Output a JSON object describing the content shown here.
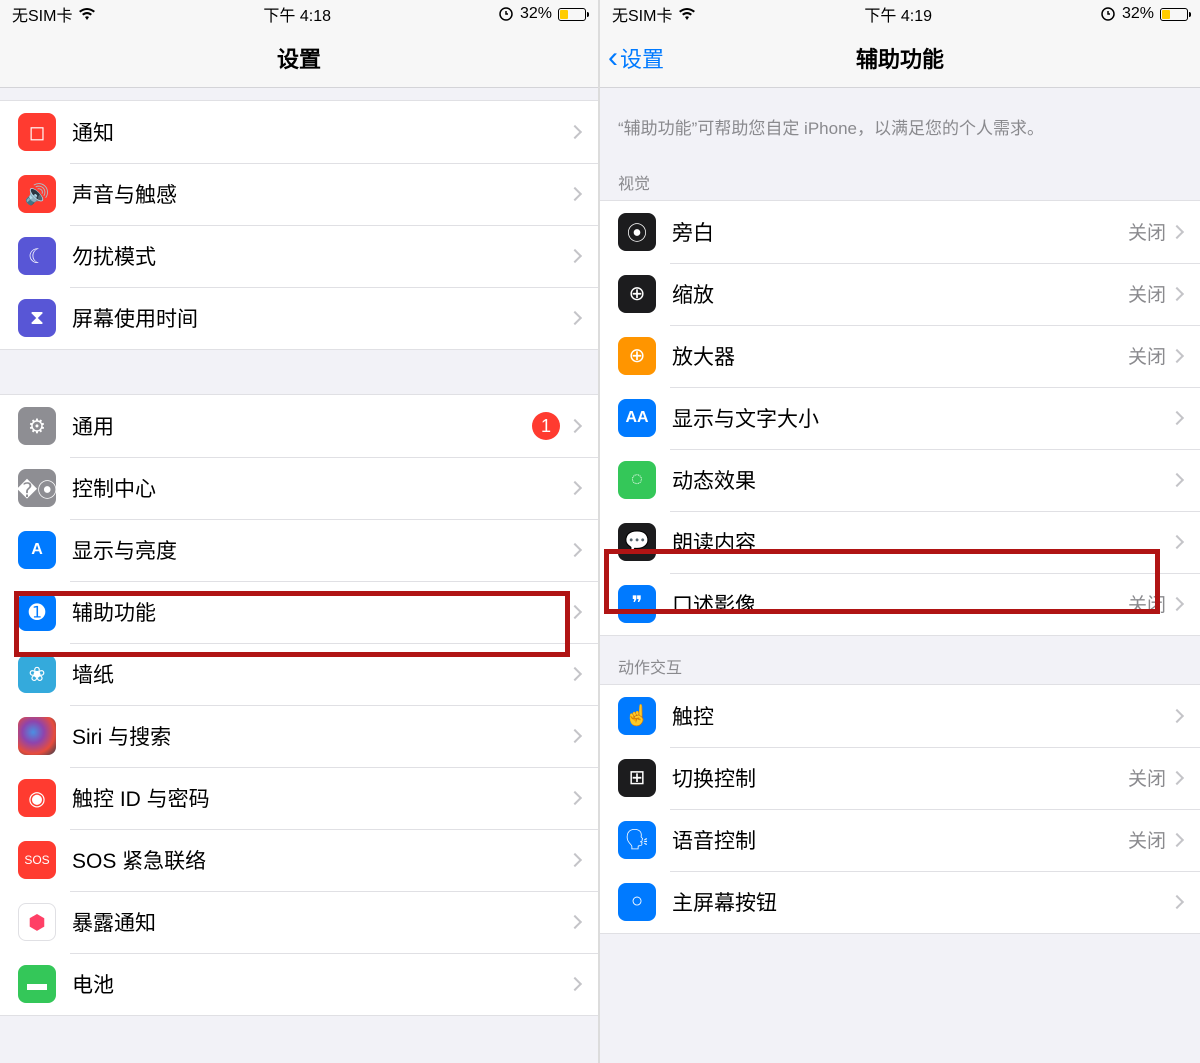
{
  "left": {
    "status": {
      "carrier": "无SIM卡",
      "time": "下午 4:18",
      "battery": "32%"
    },
    "title": "设置",
    "groups": [
      [
        {
          "key": "notifications",
          "label": "通知",
          "icon": "notification-icon",
          "iconClass": "ic-red",
          "glyph": "◻"
        },
        {
          "key": "sounds",
          "label": "声音与触感",
          "icon": "sound-icon",
          "iconClass": "ic-red",
          "glyph": "🔊"
        },
        {
          "key": "dnd",
          "label": "勿扰模式",
          "icon": "moon-icon",
          "iconClass": "ic-purple",
          "glyph": "☾"
        },
        {
          "key": "screentime",
          "label": "屏幕使用时间",
          "icon": "hourglass-icon",
          "iconClass": "ic-purple",
          "glyph": "⧗"
        }
      ],
      [
        {
          "key": "general",
          "label": "通用",
          "icon": "gear-icon",
          "iconClass": "ic-gray",
          "glyph": "⚙",
          "badge": "1"
        },
        {
          "key": "control",
          "label": "控制中心",
          "icon": "switches-icon",
          "iconClass": "ic-gray",
          "glyph": "�⦿"
        },
        {
          "key": "display",
          "label": "显示与亮度",
          "icon": "display-icon",
          "iconClass": "ic-blue",
          "glyph": "A"
        },
        {
          "key": "accessibility",
          "label": "辅助功能",
          "icon": "accessibility-icon",
          "iconClass": "ic-blue",
          "glyph": "➊",
          "highlight": true
        },
        {
          "key": "wallpaper",
          "label": "墙纸",
          "icon": "wallpaper-icon",
          "iconClass": "ic-cyan",
          "glyph": "❀"
        },
        {
          "key": "siri",
          "label": "Siri 与搜索",
          "icon": "siri-icon",
          "iconClass": "ic-siri",
          "glyph": ""
        },
        {
          "key": "touchid",
          "label": "触控 ID 与密码",
          "icon": "fingerprint-icon",
          "iconClass": "ic-red",
          "glyph": "◉"
        },
        {
          "key": "sos",
          "label": "SOS 紧急联络",
          "icon": "sos-icon",
          "iconClass": "ic-red",
          "glyph": "SOS",
          "small": true
        },
        {
          "key": "exposure",
          "label": "暴露通知",
          "icon": "exposure-icon",
          "iconClass": "ic-exposure",
          "glyph": "⬢"
        },
        {
          "key": "battery",
          "label": "电池",
          "icon": "battery-icon",
          "iconClass": "ic-green",
          "glyph": "▬"
        }
      ]
    ]
  },
  "right": {
    "status": {
      "carrier": "无SIM卡",
      "time": "下午 4:19",
      "battery": "32%"
    },
    "back": "设置",
    "title": "辅助功能",
    "description": "“辅助功能”可帮助您自定 iPhone，以满足您的个人需求。",
    "sections": [
      {
        "header": "视觉",
        "items": [
          {
            "key": "voiceover",
            "label": "旁白",
            "icon": "voiceover-icon",
            "iconClass": "ic-darker",
            "glyph": "⦿",
            "value": "关闭"
          },
          {
            "key": "zoom",
            "label": "缩放",
            "icon": "zoom-icon",
            "iconClass": "ic-darker",
            "glyph": "⊕",
            "value": "关闭"
          },
          {
            "key": "magnifier",
            "label": "放大器",
            "icon": "magnifier-icon",
            "iconClass": "ic-orange",
            "glyph": "⊕",
            "value": "关闭"
          },
          {
            "key": "textsize",
            "label": "显示与文字大小",
            "icon": "textsize-icon",
            "iconClass": "ic-blue",
            "glyph": "AA"
          },
          {
            "key": "motion",
            "label": "动态效果",
            "icon": "motion-icon",
            "iconClass": "ic-green",
            "glyph": "◌"
          },
          {
            "key": "spoken",
            "label": "朗读内容",
            "icon": "spoken-icon",
            "iconClass": "ic-darker",
            "glyph": "💬",
            "highlight": true
          },
          {
            "key": "audiodesc",
            "label": "口述影像",
            "icon": "audiodesc-icon",
            "iconClass": "ic-blue",
            "glyph": "❞",
            "value": "关闭"
          }
        ]
      },
      {
        "header": "动作交互",
        "items": [
          {
            "key": "touch",
            "label": "触控",
            "icon": "touch-icon",
            "iconClass": "ic-blue",
            "glyph": "☝"
          },
          {
            "key": "switch",
            "label": "切换控制",
            "icon": "switch-icon",
            "iconClass": "ic-darker",
            "glyph": "⊞",
            "value": "关闭"
          },
          {
            "key": "voicecontrol",
            "label": "语音控制",
            "icon": "voicecontrol-icon",
            "iconClass": "ic-blue",
            "glyph": "🗣",
            "value": "关闭"
          },
          {
            "key": "homebutton",
            "label": "主屏幕按钮",
            "icon": "homebutton-icon",
            "iconClass": "ic-blue",
            "glyph": "○"
          }
        ]
      }
    ]
  }
}
